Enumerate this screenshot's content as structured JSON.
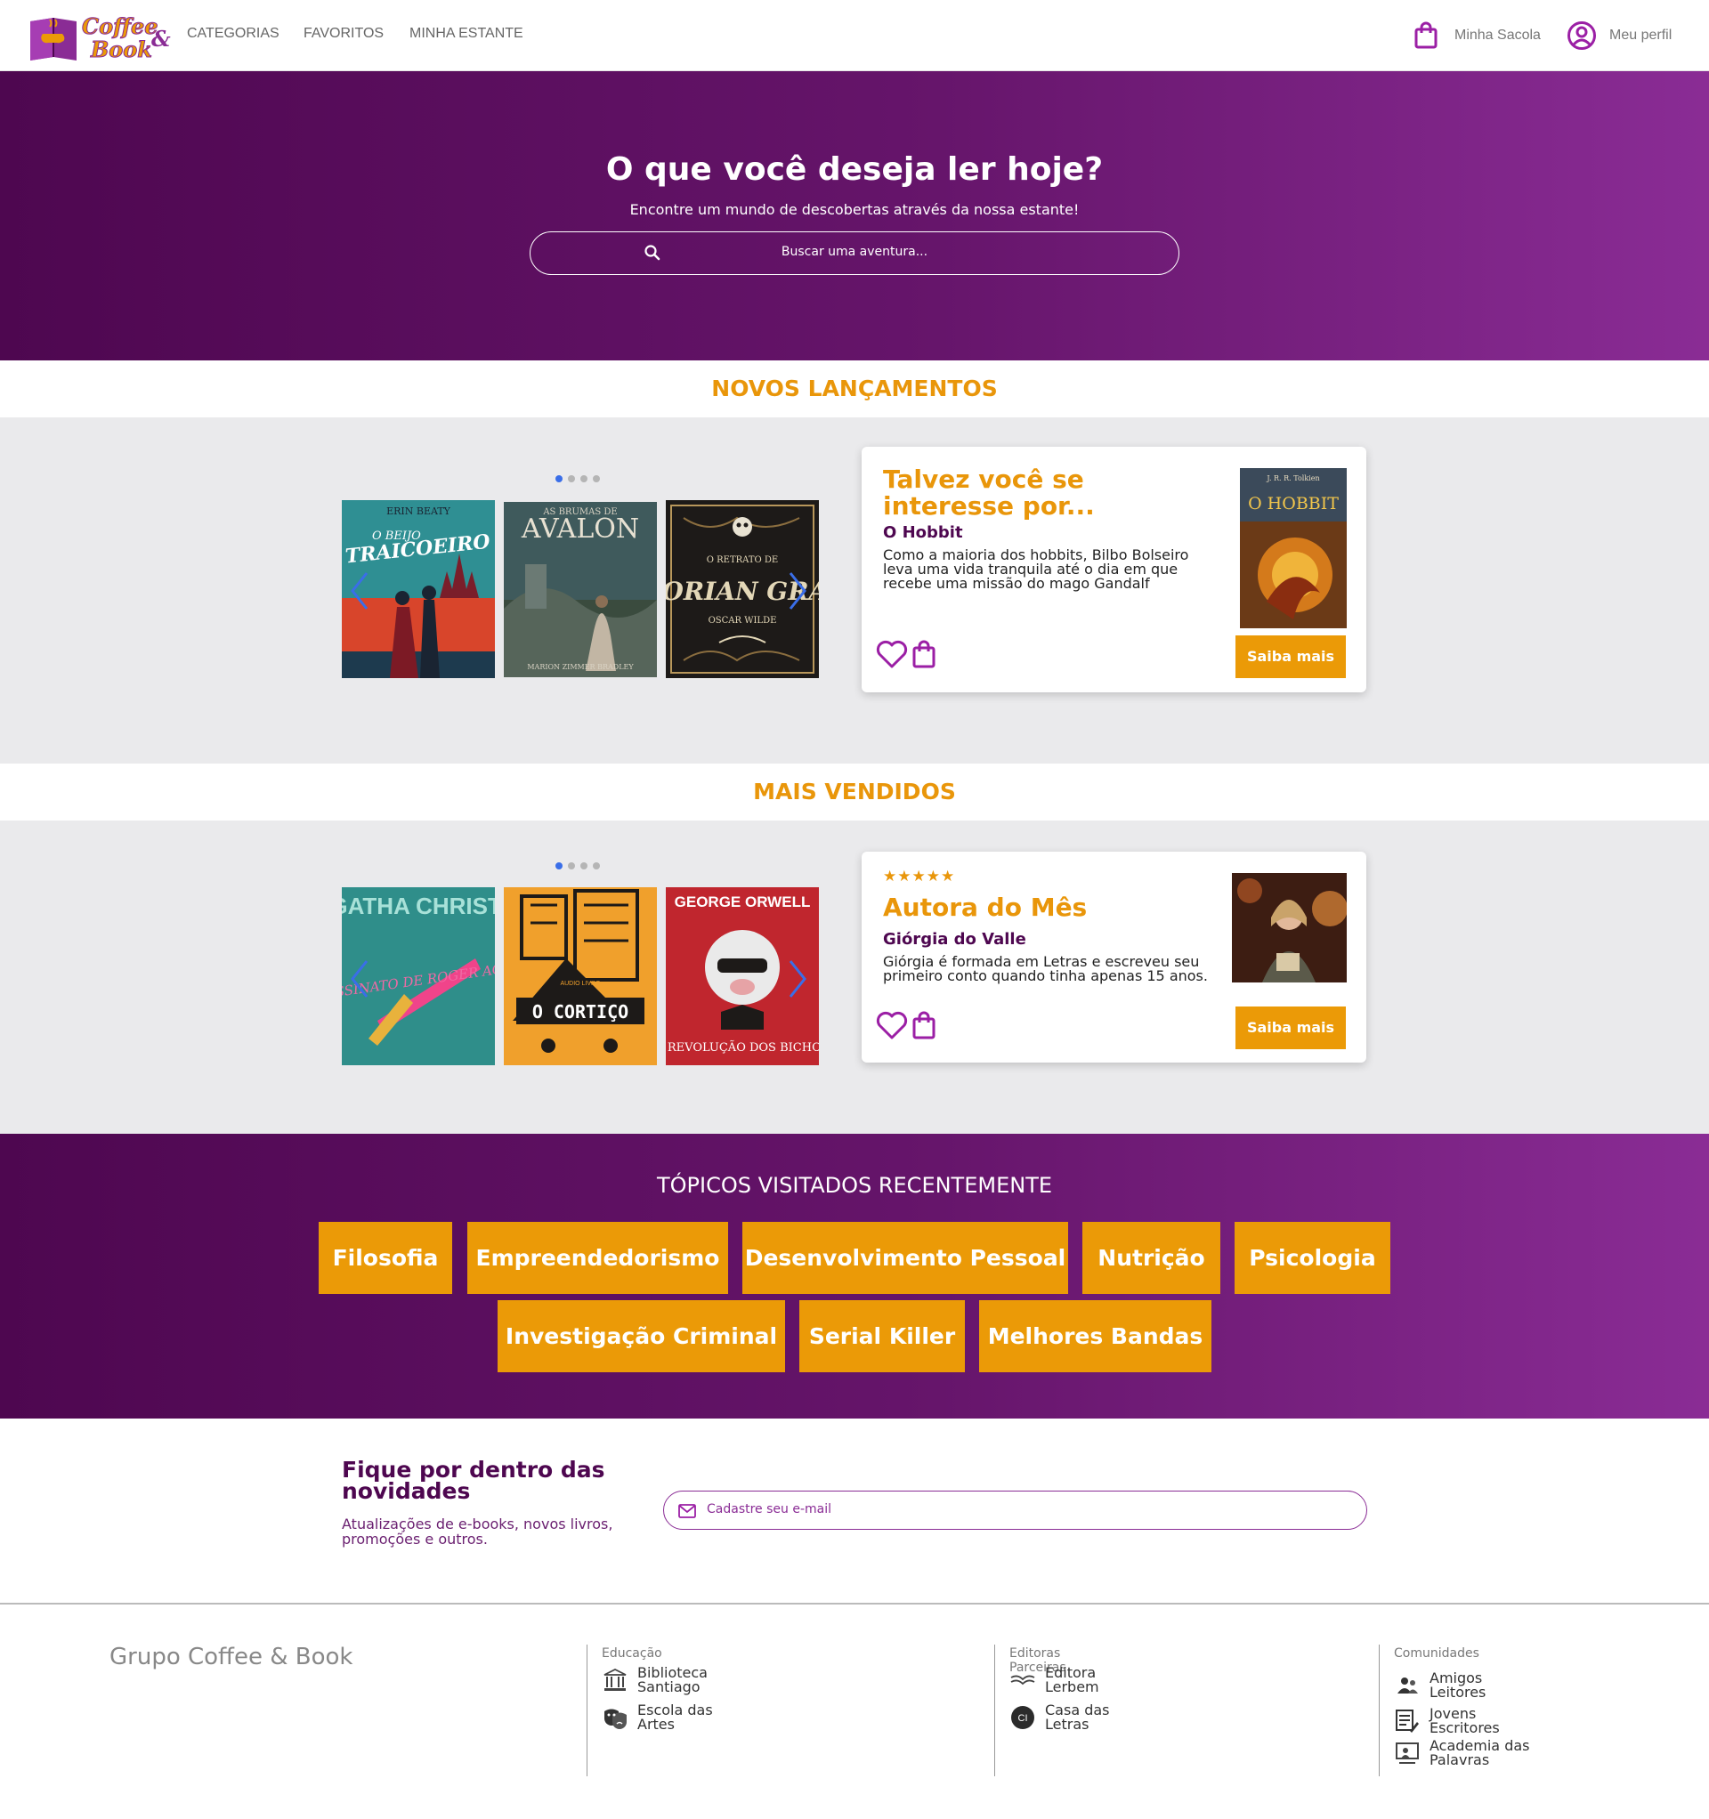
{
  "header": {
    "logo_text_top": "Coffee",
    "logo_text_bottom": "Book",
    "logo_amp": "&",
    "nav": [
      "CATEGORIAS",
      "FAVORITOS",
      "MINHA ESTANTE"
    ],
    "bag_label": "Minha Sacola",
    "profile_label": "Meu perfil"
  },
  "hero": {
    "title": "O que você deseja ler hoje?",
    "subtitle": "Encontre um mundo de descobertas através da nossa estante!",
    "search_placeholder": "Buscar uma aventura..."
  },
  "novos": {
    "title": "NOVOS LANÇAMENTOS",
    "books": [
      {
        "author": "ERIN BEATY",
        "title_top": "O BEIJO",
        "title_main": "TRAICOEIRO"
      },
      {
        "title_top": "AS BRUMAS DE",
        "title_main": "AVALON",
        "author": "MARION ZIMMER BRADLEY"
      },
      {
        "title_top": "O RETRATO DE",
        "title_main": "DORIAN GRAY",
        "author": "OSCAR WILDE"
      }
    ],
    "card": {
      "title": "Talvez você se interesse por...",
      "name": "O Hobbit",
      "desc": "Como a maioria dos hobbits, Bilbo Bolseiro leva uma vida tranquila até o dia em que recebe uma missão do mago Gandalf",
      "cover_author": "J. R. R. Tolkien",
      "cover_title": "O HOBBIT",
      "button": "Saiba mais"
    }
  },
  "vendidos": {
    "title": "MAIS VENDIDOS",
    "books": [
      {
        "author": "AGATHA CHRISTIE",
        "title_main": "O ASSASSINATO DE ROGER ACKROYD"
      },
      {
        "label": "AUDIO LIVRO",
        "title_main": "O CORTIÇO"
      },
      {
        "author": "GEORGE ORWELL",
        "title_main": "A REVOLUÇÃO DOS BICHOS"
      }
    ],
    "card": {
      "stars": "★★★★★",
      "title": "Autora do Mês",
      "name": "Giórgia do Valle",
      "desc": "Giórgia é formada em Letras e escreveu seu primeiro conto quando tinha apenas 15 anos.",
      "button": "Saiba mais"
    }
  },
  "topics": {
    "title": "TÓPICOS VISITADOS RECENTEMENTE",
    "items": [
      "Filosofia",
      "Empreendedorismo",
      "Desenvolvimento Pessoal",
      "Nutrição",
      "Psicologia",
      "Investigação Criminal",
      "Serial Killer",
      "Melhores Bandas"
    ]
  },
  "newsletter": {
    "title": "Fique por dentro das novidades",
    "subtitle": "Atualizações de e-books, novos livros, promoções e outros.",
    "placeholder": "Cadastre seu e-mail"
  },
  "footer": {
    "brand": "Grupo Coffee & Book",
    "cols": [
      {
        "heading": "Educação",
        "items": [
          "Biblioteca Santiago",
          "Escola das Artes"
        ]
      },
      {
        "heading": "Editoras Parceiras",
        "items": [
          "Editora Lerbem",
          "Casa das Letras"
        ],
        "badge": "CI"
      },
      {
        "heading": "Comunidades",
        "items": [
          "Amigos Leitores",
          "Jovens Escritores",
          "Academia das Palavras"
        ]
      }
    ]
  },
  "colors": {
    "purple": "#4e0750",
    "orange": "#eb9a07",
    "accent": "#8a2c95"
  }
}
